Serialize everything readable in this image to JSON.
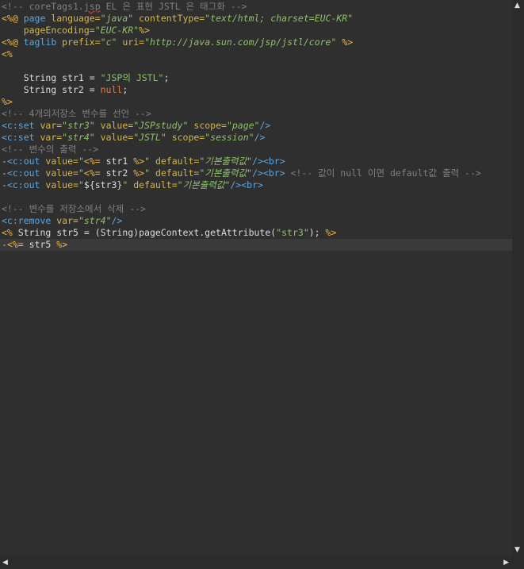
{
  "code_lines": [
    {
      "segments": [
        {
          "cls": "c-comment",
          "text": "<!-- coreTags1."
        },
        {
          "cls": "c-comment spell",
          "text": "jsp"
        },
        {
          "cls": "c-comment",
          "text": " EL 은 표현 JSTL 은 태그화 -->"
        }
      ]
    },
    {
      "segments": [
        {
          "cls": "c-directive",
          "text": "<%@ "
        },
        {
          "cls": "c-tag",
          "text": "page "
        },
        {
          "cls": "c-attr",
          "text": "language="
        },
        {
          "cls": "c-str",
          "text": "\"java\""
        },
        {
          "cls": "c-plain",
          "text": " "
        },
        {
          "cls": "c-attr",
          "text": "contentType="
        },
        {
          "cls": "c-str",
          "text": "\"text/html; charset=EUC-KR\""
        }
      ]
    },
    {
      "segments": [
        {
          "cls": "c-plain",
          "text": "    "
        },
        {
          "cls": "c-attr",
          "text": "pageEncoding="
        },
        {
          "cls": "c-str",
          "text": "\"EUC-KR\""
        },
        {
          "cls": "c-directive",
          "text": "%>"
        }
      ]
    },
    {
      "segments": [
        {
          "cls": "c-directive",
          "text": "<%@ "
        },
        {
          "cls": "c-tag",
          "text": "taglib "
        },
        {
          "cls": "c-attr",
          "text": "prefix="
        },
        {
          "cls": "c-str",
          "text": "\"c\""
        },
        {
          "cls": "c-plain",
          "text": " "
        },
        {
          "cls": "c-attr",
          "text": "uri="
        },
        {
          "cls": "c-str",
          "text": "\"http://java.sun.com/jsp/jstl/core\""
        },
        {
          "cls": "c-plain",
          "text": " "
        },
        {
          "cls": "c-directive",
          "text": "%>"
        }
      ]
    },
    {
      "segments": [
        {
          "cls": "c-directive",
          "text": "<%"
        }
      ]
    },
    {
      "segments": []
    },
    {
      "segments": [
        {
          "cls": "c-plain",
          "text": "    String str1 = "
        },
        {
          "cls": "c-str-plain",
          "text": "\"JSP의 JSTL\""
        },
        {
          "cls": "c-plain",
          "text": ";"
        }
      ]
    },
    {
      "segments": [
        {
          "cls": "c-plain",
          "text": "    String str2 = "
        },
        {
          "cls": "c-kw",
          "text": "null"
        },
        {
          "cls": "c-plain",
          "text": ";"
        }
      ]
    },
    {
      "segments": [
        {
          "cls": "c-directive",
          "text": "%>"
        }
      ]
    },
    {
      "segments": [
        {
          "cls": "c-comment",
          "text": "<!-- 4개의저장소 변수를 선언 -->"
        }
      ]
    },
    {
      "segments": [
        {
          "cls": "c-tag",
          "text": "<c:set "
        },
        {
          "cls": "c-attr",
          "text": "var="
        },
        {
          "cls": "c-str",
          "text": "\"str3\""
        },
        {
          "cls": "c-plain",
          "text": " "
        },
        {
          "cls": "c-attr",
          "text": "value="
        },
        {
          "cls": "c-str",
          "text": "\"JSPstudy\""
        },
        {
          "cls": "c-plain",
          "text": " "
        },
        {
          "cls": "c-attr",
          "text": "scope="
        },
        {
          "cls": "c-str",
          "text": "\"page\""
        },
        {
          "cls": "c-tag",
          "text": "/>"
        }
      ]
    },
    {
      "segments": [
        {
          "cls": "c-tag",
          "text": "<c:set "
        },
        {
          "cls": "c-attr",
          "text": "var="
        },
        {
          "cls": "c-str",
          "text": "\"str4\""
        },
        {
          "cls": "c-plain",
          "text": " "
        },
        {
          "cls": "c-attr",
          "text": "value="
        },
        {
          "cls": "c-str",
          "text": "\"JSTL\""
        },
        {
          "cls": "c-plain",
          "text": " "
        },
        {
          "cls": "c-attr",
          "text": "scope="
        },
        {
          "cls": "c-str",
          "text": "\"session\""
        },
        {
          "cls": "c-tag",
          "text": "/>"
        }
      ]
    },
    {
      "segments": [
        {
          "cls": "c-comment",
          "text": "<!-- 변수의 출력 -->"
        }
      ]
    },
    {
      "segments": [
        {
          "cls": "gutter",
          "text": "-"
        },
        {
          "cls": "c-tag",
          "text": "<c:out "
        },
        {
          "cls": "c-attr",
          "text": "value="
        },
        {
          "cls": "c-str-plain",
          "text": "\""
        },
        {
          "cls": "c-directive",
          "text": "<%= "
        },
        {
          "cls": "c-plain",
          "text": "str1 "
        },
        {
          "cls": "c-directive",
          "text": "%>"
        },
        {
          "cls": "c-str-plain",
          "text": "\""
        },
        {
          "cls": "c-plain",
          "text": " "
        },
        {
          "cls": "c-attr",
          "text": "default="
        },
        {
          "cls": "c-str",
          "text": "\"기본출력값\""
        },
        {
          "cls": "c-tag",
          "text": "/><br>"
        }
      ]
    },
    {
      "segments": [
        {
          "cls": "gutter",
          "text": "-"
        },
        {
          "cls": "c-tag",
          "text": "<c:out "
        },
        {
          "cls": "c-attr",
          "text": "value="
        },
        {
          "cls": "c-str-plain",
          "text": "\""
        },
        {
          "cls": "c-directive",
          "text": "<%= "
        },
        {
          "cls": "c-plain",
          "text": "str2 "
        },
        {
          "cls": "c-directive",
          "text": "%>"
        },
        {
          "cls": "c-str-plain",
          "text": "\""
        },
        {
          "cls": "c-plain",
          "text": " "
        },
        {
          "cls": "c-attr",
          "text": "default="
        },
        {
          "cls": "c-str",
          "text": "\"기본출력값\""
        },
        {
          "cls": "c-tag",
          "text": "/><br>"
        },
        {
          "cls": "c-plain",
          "text": " "
        },
        {
          "cls": "c-comment",
          "text": "<!-- 값이 null 이면 default값 출력 -->"
        }
      ]
    },
    {
      "segments": [
        {
          "cls": "gutter",
          "text": "-"
        },
        {
          "cls": "c-tag",
          "text": "<c:out "
        },
        {
          "cls": "c-attr",
          "text": "value="
        },
        {
          "cls": "c-str-plain",
          "text": "\""
        },
        {
          "cls": "c-plain",
          "text": "${str3}"
        },
        {
          "cls": "c-str-plain",
          "text": "\""
        },
        {
          "cls": "c-plain",
          "text": " "
        },
        {
          "cls": "c-attr",
          "text": "default="
        },
        {
          "cls": "c-str",
          "text": "\"기본출력값\""
        },
        {
          "cls": "c-tag",
          "text": "/><br>"
        }
      ]
    },
    {
      "segments": []
    },
    {
      "segments": [
        {
          "cls": "c-comment",
          "text": "<!-- 변수를 저장소에서 삭제 -->"
        }
      ]
    },
    {
      "segments": [
        {
          "cls": "c-tag",
          "text": "<c:remove "
        },
        {
          "cls": "c-attr",
          "text": "var="
        },
        {
          "cls": "c-str",
          "text": "\"str4\""
        },
        {
          "cls": "c-tag",
          "text": "/>"
        }
      ]
    },
    {
      "segments": [
        {
          "cls": "c-directive",
          "text": "<% "
        },
        {
          "cls": "c-plain",
          "text": "String str5 = (String)pageContext.getAttribute("
        },
        {
          "cls": "c-str-plain",
          "text": "\"str3\""
        },
        {
          "cls": "c-plain",
          "text": "); "
        },
        {
          "cls": "c-directive",
          "text": "%>"
        }
      ]
    },
    {
      "segments": [
        {
          "cls": "gutter",
          "text": "-"
        },
        {
          "cls": "c-directive",
          "text": "<%= "
        },
        {
          "cls": "c-plain",
          "text": "str5 "
        },
        {
          "cls": "c-directive",
          "text": "%>"
        }
      ],
      "current": true
    }
  ],
  "scrollbar": {
    "up_arrow": "▲",
    "down_arrow": "▼",
    "left_arrow": "◀",
    "right_arrow": "▶"
  }
}
